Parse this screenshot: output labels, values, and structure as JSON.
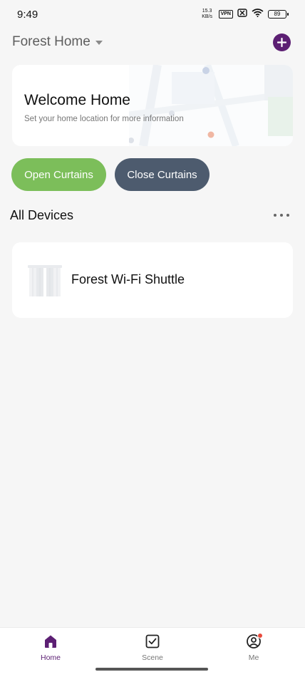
{
  "status_bar": {
    "time": "9:49",
    "speed_value": "15.3",
    "speed_unit": "KB/s",
    "vpn": "VPN",
    "battery": "89"
  },
  "header": {
    "home_name": "Forest Home"
  },
  "welcome": {
    "title": "Welcome Home",
    "subtitle": "Set your home location for more information"
  },
  "actions": {
    "open_label": "Open Curtains",
    "close_label": "Close Curtains"
  },
  "devices": {
    "section_title": "All Devices",
    "items": [
      {
        "name": "Forest Wi-Fi Shuttle",
        "icon": "curtain-icon"
      }
    ]
  },
  "bottom_nav": {
    "items": [
      {
        "label": "Home",
        "icon": "home-icon",
        "active": true
      },
      {
        "label": "Scene",
        "icon": "scene-checkbox-icon",
        "active": false
      },
      {
        "label": "Me",
        "icon": "profile-icon",
        "active": false,
        "badge": true
      }
    ]
  },
  "colors": {
    "brand": "#5c1f73",
    "open_button": "#7cbe5a",
    "close_button": "#4d5b6e",
    "badge": "#e84a3c"
  }
}
